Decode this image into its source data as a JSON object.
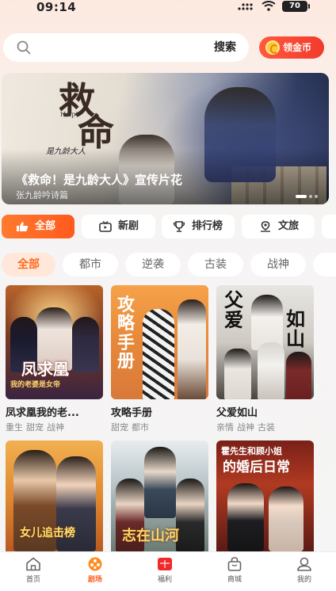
{
  "status_bar": {
    "time": "09:14",
    "battery": "70"
  },
  "search": {
    "placeholder": "",
    "button_label": "搜索"
  },
  "coin_button": {
    "label": "领金币"
  },
  "banner": {
    "logo_line1": "救",
    "logo_line2": "命",
    "logo_help": "Help!",
    "logo_sub": "是九龄大人",
    "title": "《救命！是九龄大人》宣传片花",
    "subtitle": "张九龄吟诗篇"
  },
  "category_tabs": [
    {
      "label": "全部",
      "icon": "thumbs-up-icon",
      "active": true
    },
    {
      "label": "新剧",
      "icon": "tv-icon",
      "active": false
    },
    {
      "label": "排行榜",
      "icon": "trophy-icon",
      "active": false
    },
    {
      "label": "文旅",
      "icon": "location-icon",
      "active": false
    }
  ],
  "genre_chips": [
    {
      "label": "全部",
      "active": true
    },
    {
      "label": "都市",
      "active": false
    },
    {
      "label": "逆袭",
      "active": false
    },
    {
      "label": "古装",
      "active": false
    },
    {
      "label": "战神",
      "active": false
    }
  ],
  "dramas": [
    {
      "title": "凤求凰我的老...",
      "tags": [
        "重生",
        "甜宠",
        "战神"
      ],
      "poster_text": [
        "凤求凰",
        "我的老婆是女帝"
      ]
    },
    {
      "title": "攻略手册",
      "tags": [
        "甜宠",
        "都市"
      ],
      "poster_text": [
        "攻略",
        "手册"
      ]
    },
    {
      "title": "父爱如山",
      "tags": [
        "亲情",
        "战神",
        "古装"
      ],
      "poster_text": [
        "父爱",
        "如山"
      ]
    },
    {
      "title": "",
      "tags": [],
      "poster_text": [
        "女儿追击榜"
      ]
    },
    {
      "title": "",
      "tags": [],
      "poster_text": [
        "志在山河"
      ]
    },
    {
      "title": "",
      "tags": [],
      "poster_text": [
        "霍先生和顾小姐",
        "的婚后日常"
      ]
    }
  ],
  "bottom_nav": [
    {
      "label": "首页",
      "icon": "home-icon",
      "active": false
    },
    {
      "label": "剧场",
      "icon": "film-reel-icon",
      "active": true
    },
    {
      "label": "福利",
      "icon": "gift-icon",
      "active": false
    },
    {
      "label": "商城",
      "icon": "shopping-bag-icon",
      "active": false
    },
    {
      "label": "我的",
      "icon": "profile-icon",
      "active": false
    }
  ],
  "colors": {
    "accent": "#ff5a1e",
    "coin_button": "#f23a2c",
    "chip_active_bg": "#ffe8d9"
  }
}
